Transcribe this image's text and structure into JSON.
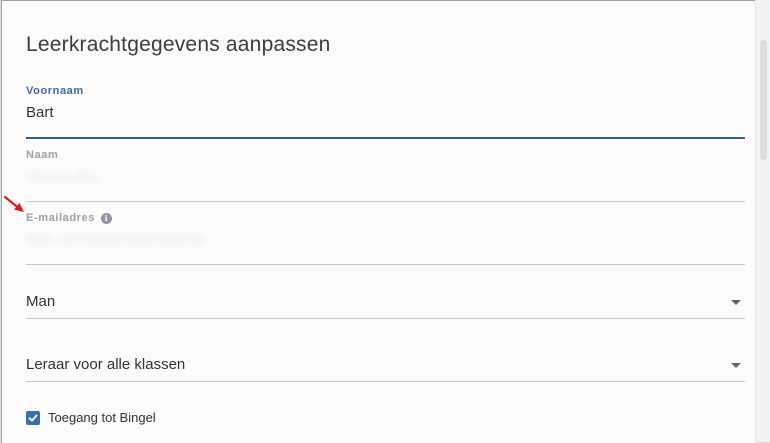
{
  "dialog": {
    "title": "Leerkrachtgegevens aanpassen"
  },
  "fields": {
    "firstname": {
      "label": "Voornaam",
      "value": "Bart"
    },
    "lastname": {
      "label": "Naam",
      "value": "Vermeulen"
    },
    "email": {
      "label": "E-mailadres",
      "value": "bart.vermeulen@school.be",
      "info_icon": "info-icon"
    },
    "gender": {
      "value": "Man",
      "icon": "chevron-down-icon"
    },
    "role": {
      "value": "Leraar voor alle klassen",
      "icon": "chevron-down-icon"
    }
  },
  "access": {
    "label": "Toegang tot Bingel",
    "checked": true
  },
  "colors": {
    "accent": "#2f5f95",
    "checkbox": "#3b6eb0",
    "annotation_arrow": "#e01818"
  }
}
